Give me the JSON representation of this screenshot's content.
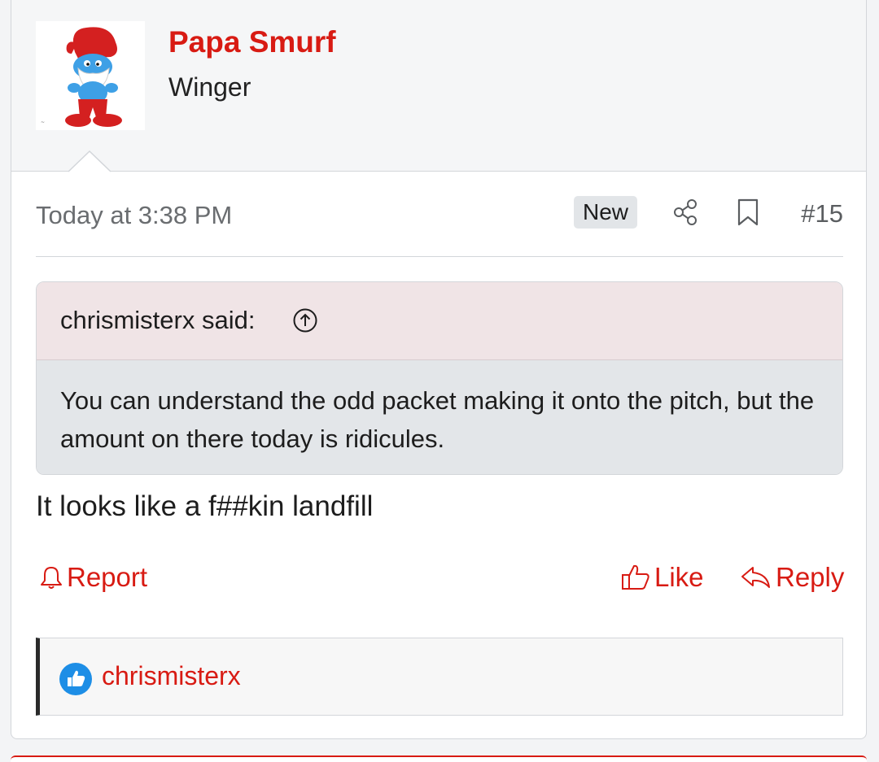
{
  "post": {
    "author": "Papa Smurf",
    "author_title": "Winger",
    "timestamp": "Today at 3:38 PM",
    "badge": "New",
    "number": "#15",
    "quote": {
      "author_label": "chrismisterx said:",
      "text": "You can understand the odd packet making it onto the pitch, but the amount on there today is ridicules."
    },
    "body": "It looks like a f##kin landfill",
    "actions": {
      "report": "Report",
      "like": "Like",
      "reply": "Reply"
    },
    "reactions": {
      "user": "chrismisterx",
      "icon": "like-reaction-icon"
    }
  },
  "colors": {
    "accent": "#d81b13",
    "quote_head_bg": "#f0e4e6",
    "quote_body_bg": "#e3e6e9",
    "reaction_blue": "#1d8ee6"
  }
}
